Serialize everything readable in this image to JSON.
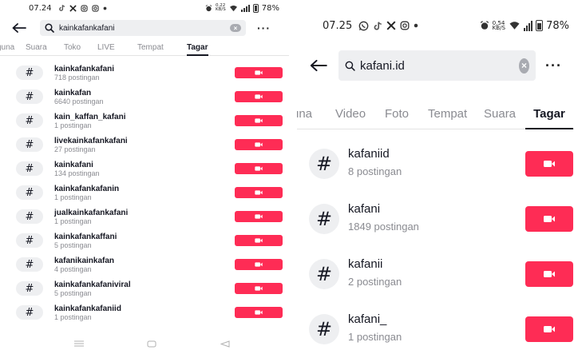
{
  "colors": {
    "accent": "#fe2c55",
    "text": "#161823",
    "muted": "#8a8b91",
    "chip": "#eeeff1"
  },
  "left": {
    "status": {
      "time": "07.24",
      "notifications": [
        "tiktok-icon",
        "x-icon",
        "instagram-icon",
        "instagram-icon",
        "dot"
      ],
      "speed_value": "0,22",
      "speed_unit": "KB/S",
      "battery": "78%"
    },
    "search": {
      "query": "kainkafankafani"
    },
    "tabs": [
      {
        "label": "guna",
        "active": false
      },
      {
        "label": "Suara",
        "active": false
      },
      {
        "label": "Toko",
        "active": false
      },
      {
        "label": "LIVE",
        "active": false
      },
      {
        "label": "Tempat",
        "active": false
      },
      {
        "label": "Tagar",
        "active": true
      }
    ],
    "results": [
      {
        "name": "kainkafankafani",
        "count": "718 postingan"
      },
      {
        "name": "kainkafan",
        "count": "6640 postingan"
      },
      {
        "name": "kain_kaffan_kafani",
        "count": "1 postingan"
      },
      {
        "name": "livekainkafankafani",
        "count": "27 postingan"
      },
      {
        "name": "kainkafani",
        "count": "134 postingan"
      },
      {
        "name": "kainkafankafanin",
        "count": "1 postingan"
      },
      {
        "name": "jualkainkafankafani",
        "count": "1 postingan"
      },
      {
        "name": "kainkafankaffani",
        "count": "5 postingan"
      },
      {
        "name": "kafanikainkafan",
        "count": "4 postingan"
      },
      {
        "name": "kainkafankafaniviral",
        "count": "5 postingan"
      },
      {
        "name": "kainkafankafaniid",
        "count": "1 postingan"
      }
    ]
  },
  "right": {
    "status": {
      "time": "07.25",
      "notifications": [
        "whatsapp-icon",
        "tiktok-icon",
        "x-icon",
        "instagram-icon",
        "dot"
      ],
      "speed_value": "0,54",
      "speed_unit": "KB/S",
      "battery": "78%"
    },
    "search": {
      "query": "kafani.id"
    },
    "tabs": [
      {
        "label": "una",
        "active": false
      },
      {
        "label": "Video",
        "active": false
      },
      {
        "label": "Foto",
        "active": false
      },
      {
        "label": "Tempat",
        "active": false
      },
      {
        "label": "Suara",
        "active": false
      },
      {
        "label": "Tagar",
        "active": true
      }
    ],
    "results": [
      {
        "name": "kafaniid",
        "count": "8 postingan"
      },
      {
        "name": "kafani",
        "count": "1849 postingan"
      },
      {
        "name": "kafanii",
        "count": "2 postingan"
      },
      {
        "name": "kafani_",
        "count": "1 postingan"
      }
    ]
  }
}
